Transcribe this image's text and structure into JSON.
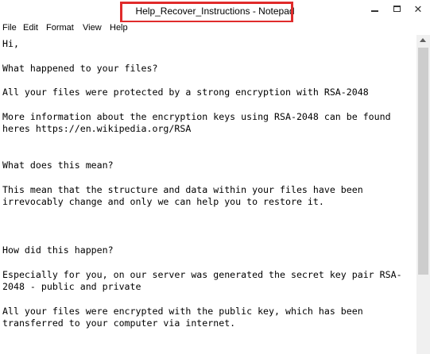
{
  "window": {
    "title": "Help_Recover_Instructions - Notepad",
    "close_glyph": "✕"
  },
  "menu": {
    "file": "File",
    "edit": "Edit",
    "format": "Format",
    "view": "View",
    "help": "Help"
  },
  "document": {
    "text": "Hi,\n\nWhat happened to your files?\n\nAll your files were protected by a strong encryption with RSA-2048\n\nMore information about the encryption keys using RSA-2048 can be found\nheres https://en.wikipedia.org/RSA\n\n\nWhat does this mean?\n\nThis mean that the structure and data within your files have been\nirrevocably change and only we can help you to restore it.\n\n\n\nHow did this happen?\n\nEspecially for you, on our server was generated the secret key pair RSA-\n2048 - public and private\n\nAll your files were encrypted with the public key, which has been\ntransferred to your computer via internet."
  },
  "colors": {
    "highlight_box": "#e02b2b",
    "scrollbar_track": "#f0f0f0",
    "scrollbar_thumb": "#cdcdcd"
  },
  "icons": {
    "minimize": "minimize-icon",
    "maximize": "maximize-icon",
    "close": "close-icon",
    "scroll_up": "scroll-up-arrow-icon"
  }
}
